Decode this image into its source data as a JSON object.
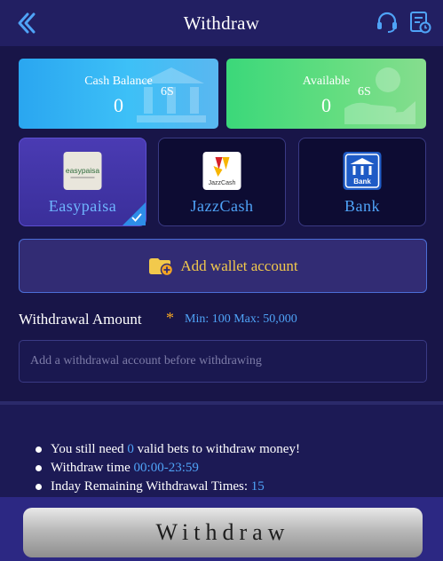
{
  "header": {
    "title": "Withdraw"
  },
  "balances": {
    "cash": {
      "label": "Cash Balance",
      "value": "0",
      "countdown": "6S"
    },
    "available": {
      "label": "Available",
      "value": "0",
      "countdown": "6S"
    }
  },
  "methods": [
    {
      "name": "Easypaisa",
      "logo_text": "easypaisa",
      "selected": true
    },
    {
      "name": "JazzCash",
      "logo_text": "JazzCash",
      "selected": false
    },
    {
      "name": "Bank",
      "logo_text": "Bank",
      "selected": false
    }
  ],
  "wallet": {
    "add_label": "Add wallet account"
  },
  "amount": {
    "title": "Withdrawal Amount",
    "required_mark": "*",
    "range": "Min: 100 Max: 50,000",
    "placeholder": "Add a withdrawal account before withdrawing"
  },
  "notes": {
    "bets_prefix": "You still need ",
    "bets_value": "0",
    "bets_suffix": " valid bets to withdraw money!",
    "time_prefix": "Withdraw time ",
    "time_value": "00:00-23:59",
    "remain_prefix": "Inday Remaining Withdrawal Times: ",
    "remain_value": "15"
  },
  "footer": {
    "button_label": "Withdraw"
  },
  "colors": {
    "accent_blue": "#4fa3f7",
    "accent_gold": "#f2c94c",
    "background": "#1c1a55"
  }
}
